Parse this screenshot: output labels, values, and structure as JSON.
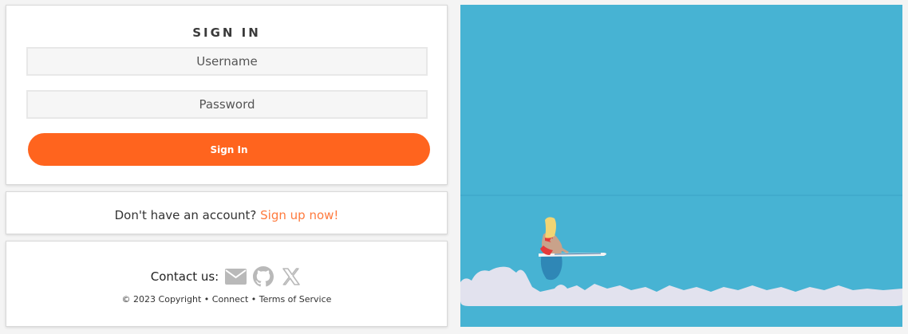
{
  "signin": {
    "title": "SIGN IN",
    "username_placeholder": "Username",
    "password_placeholder": "Password",
    "button_label": "Sign In"
  },
  "signup": {
    "prompt": "Don't have an account?",
    "link_label": "Sign up now!"
  },
  "contact": {
    "label": "Contact us:",
    "icons": [
      "envelope-icon",
      "github-icon",
      "x-twitter-icon"
    ]
  },
  "footer": {
    "copyright": "© 2023 Copyright",
    "sep1": "•",
    "connect": "Connect",
    "sep2": "•",
    "terms": "Terms of Service"
  },
  "colors": {
    "accent": "#ff641e",
    "link": "#ff7a3d",
    "water": "#47b3d3",
    "ice": "#e2e2ee"
  }
}
